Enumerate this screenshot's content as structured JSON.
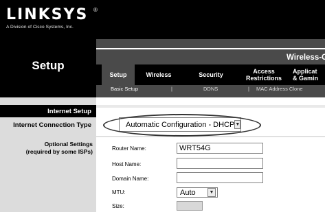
{
  "brand": {
    "logo": "LINKSYS",
    "registered": "®",
    "tagline": "A Division of Cisco Systems, Inc."
  },
  "header": {
    "section_title": "Setup",
    "product_name": "Wireless-G"
  },
  "tabs": [
    {
      "label": "Setup",
      "active": true
    },
    {
      "label": "Wireless",
      "active": false
    },
    {
      "label": "Security",
      "active": false
    },
    {
      "label": "Access\nRestrictions",
      "active": false
    },
    {
      "label": "Applicat\n& Gamin",
      "active": false
    }
  ],
  "subtabs": [
    {
      "label": "Basic Setup",
      "active": true
    },
    {
      "label": "DDNS",
      "active": false
    },
    {
      "label": "MAC Address Clone",
      "active": false
    }
  ],
  "subtab_separator": "|",
  "sidebar": {
    "heading": "Internet Setup",
    "connection_type_label": "Internet Connection Type",
    "optional_settings_label": "Optional Settings\n(required by some ISPs)"
  },
  "connection": {
    "selected": "Automatic Configuration - DHCP"
  },
  "fields": {
    "router_name": {
      "label": "Router Name:",
      "value": "WRT54G"
    },
    "host_name": {
      "label": "Host Name:",
      "value": ""
    },
    "domain_name": {
      "label": "Domain Name:",
      "value": ""
    },
    "mtu": {
      "label": "MTU:",
      "value": "Auto"
    },
    "size": {
      "label": "Size:",
      "value": ""
    }
  },
  "icons": {
    "dropdown": "chevron-down-icon"
  },
  "colors": {
    "header_black": "#000000",
    "header_gray": "#4a4a4a",
    "sidebar_gray": "#dcdcdc",
    "highlight_ring": "#333333"
  }
}
